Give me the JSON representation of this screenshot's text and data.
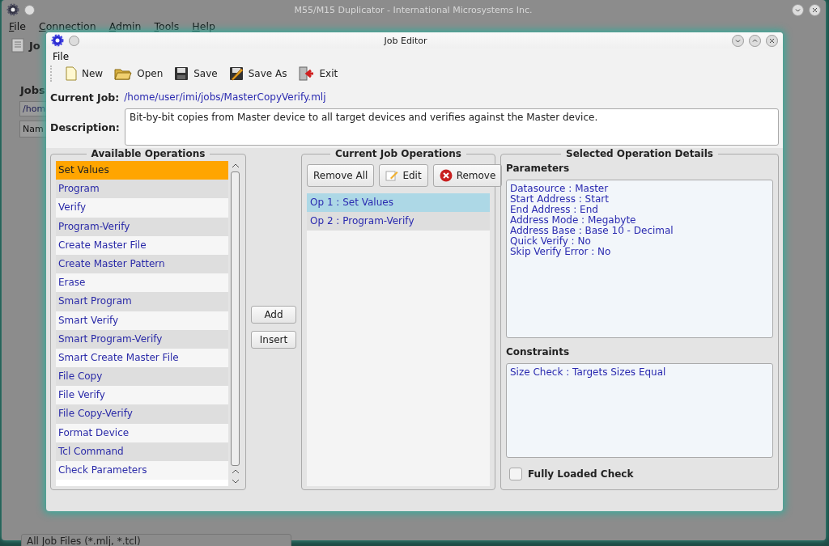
{
  "main_window": {
    "title": "M55/M15 Duplicator - International Microsystems Inc.",
    "menu": [
      "File",
      "Connection",
      "Admin",
      "Tools",
      "Help"
    ],
    "tab_label": "Jo",
    "jobs_label": "Jobs",
    "path_field": "/hom",
    "column_header": "Nam",
    "filter_combo": "All Job Files (*.mlj, *.tcl)"
  },
  "job_editor": {
    "title": "Job Editor",
    "menu": [
      "File"
    ],
    "toolbar": [
      {
        "label": "New",
        "kind": "new"
      },
      {
        "label": "Open",
        "kind": "open"
      },
      {
        "label": "Save",
        "kind": "save"
      },
      {
        "label": "Save As",
        "kind": "saveas"
      },
      {
        "label": "Exit",
        "kind": "exit"
      }
    ],
    "current_job": {
      "label": "Current Job:",
      "value": "/home/user/imi/jobs/MasterCopyVerify.mlj"
    },
    "description": {
      "label": "Description:",
      "value": "Bit-by-bit copies from Master device to all target devices and verifies against the Master device."
    },
    "available_operations": {
      "title": "Available Operations",
      "items": [
        {
          "label": "Set Values",
          "selected": true
        },
        {
          "label": "Program",
          "selected": false
        },
        {
          "label": "Verify",
          "selected": false
        },
        {
          "label": "Program-Verify",
          "selected": false
        },
        {
          "label": "Create Master File",
          "selected": false
        },
        {
          "label": "Create Master Pattern",
          "selected": false
        },
        {
          "label": "Erase",
          "selected": false
        },
        {
          "label": "Smart Program",
          "selected": false
        },
        {
          "label": "Smart Verify",
          "selected": false
        },
        {
          "label": "Smart Program-Verify",
          "selected": false
        },
        {
          "label": "Smart Create Master File",
          "selected": false
        },
        {
          "label": "File Copy",
          "selected": false
        },
        {
          "label": "File Verify",
          "selected": false
        },
        {
          "label": "File Copy-Verify",
          "selected": false
        },
        {
          "label": "Format Device",
          "selected": false
        },
        {
          "label": "Tcl Command",
          "selected": false
        },
        {
          "label": "Check Parameters",
          "selected": false
        }
      ]
    },
    "add_buttons": [
      "Add",
      "Insert"
    ],
    "current_job_operations": {
      "title": "Current Job Operations",
      "buttons": [
        {
          "label": "Remove All",
          "kind": "plain"
        },
        {
          "label": "Edit",
          "kind": "edit"
        },
        {
          "label": "Remove",
          "kind": "remove"
        }
      ],
      "items": [
        {
          "label": "Op 1 : Set Values",
          "selected": true
        },
        {
          "label": "Op 2 : Program-Verify",
          "selected": false
        }
      ]
    },
    "details": {
      "title": "Selected Operation Details",
      "parameters_label": "Parameters",
      "parameters": [
        "Datasource : Master",
        "Start Address : Start",
        "End Address : End",
        "Address Mode : Megabyte",
        "Address Base : Base 10 - Decimal",
        "Quick Verify : No",
        "Skip Verify Error : No"
      ],
      "constraints_label": "Constraints",
      "constraints": [
        "Size Check : Targets Sizes Equal"
      ],
      "fully_loaded_check": {
        "label": "Fully Loaded Check",
        "checked": false
      }
    }
  }
}
